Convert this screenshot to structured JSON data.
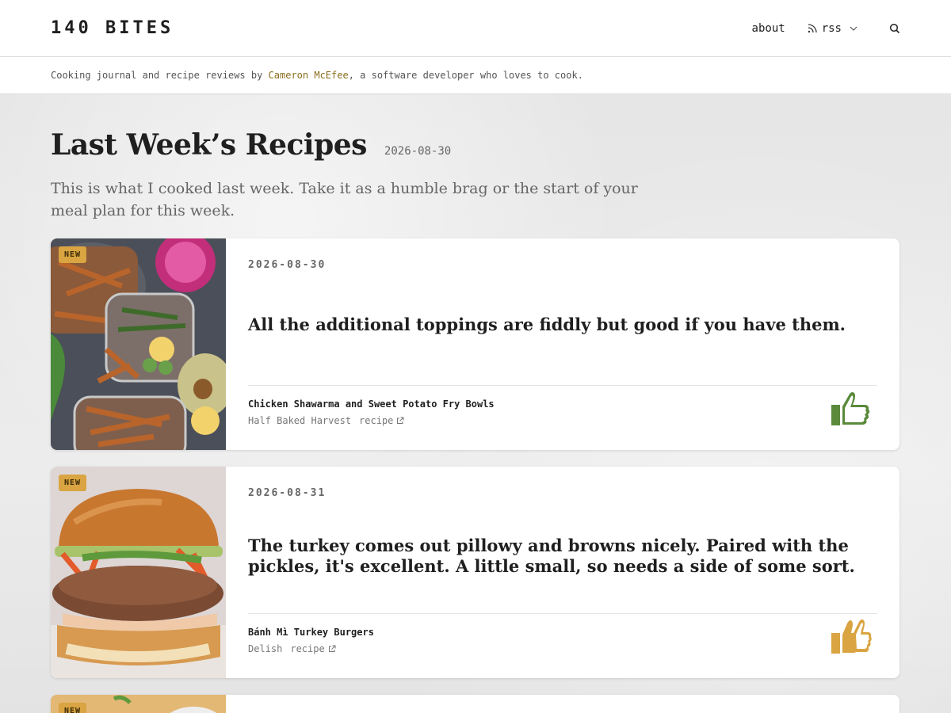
{
  "site": {
    "logo": "140 BITES",
    "nav": {
      "about": "about",
      "rss": "rss"
    },
    "tagline_before": "Cooking journal and recipe reviews by ",
    "tagline_author": "Cameron McEfee",
    "tagline_after": ", a software developer who loves to cook."
  },
  "page": {
    "title": "Last Week’s Recipes",
    "date": "2026-08-30",
    "intro": "This is what I cooked last week. Take it as a humble brag or the start of your meal plan for this week."
  },
  "cards": [
    {
      "badge": "NEW",
      "date": "2026-08-30",
      "quote": "All the additional toppings are fiddly but good if you have them.",
      "recipe_name": "Chicken Shawarma and Sweet Potato Fry Bowls",
      "source": "Half Baked Harvest",
      "link_label": "recipe",
      "rating_icon": "thumbs-up-icon",
      "rating_color": "#5a8a3a"
    },
    {
      "badge": "NEW",
      "date": "2026-08-31",
      "quote": "The turkey comes out pillowy and browns nicely. Paired with the pickles, it's excellent. A little small, so needs a side of some sort.",
      "recipe_name": "Bánh Mì Turkey Burgers",
      "source": "Delish",
      "link_label": "recipe",
      "rating_icon": "double-thumbs-up-icon",
      "rating_color": "#d9a441"
    },
    {
      "badge": "NEW"
    }
  ]
}
